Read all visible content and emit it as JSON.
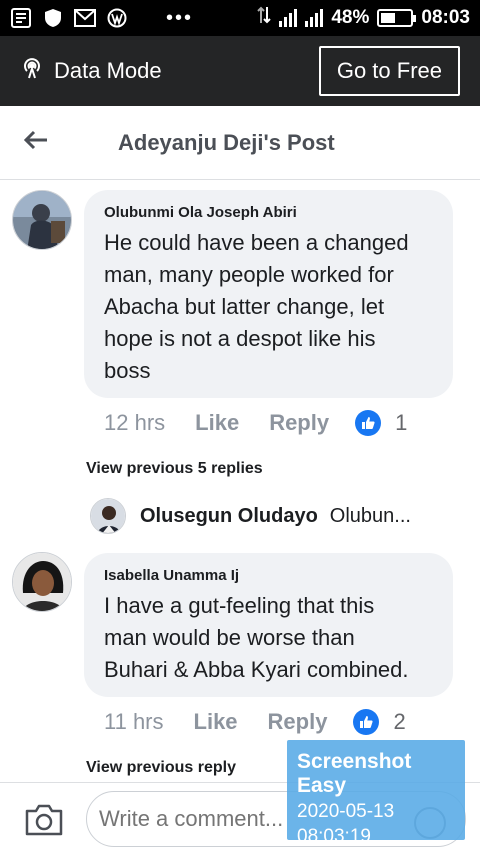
{
  "status_bar": {
    "battery": "48%",
    "time": "08:03",
    "battery_level": 0.48,
    "icons": [
      "news-icon",
      "shield-icon",
      "gmail-icon",
      "wordpress-icon"
    ]
  },
  "data_bar": {
    "label": "Data Mode",
    "go_free": "Go to Free"
  },
  "header": {
    "title": "Adeyanju Deji's Post"
  },
  "comments": [
    {
      "author": "Olubunmi Ola Joseph Abiri",
      "text_lines": [
        "He could have been a changed",
        "man, many people worked for",
        "Abacha but latter change, let",
        "hope is not a despot like his",
        "boss"
      ],
      "time": "12 hrs",
      "like": "Like",
      "reply": "Reply",
      "likes": "1",
      "view_replies": "View previous 5 replies",
      "reply_preview": {
        "name": "Olusegun Oludayo",
        "text": "Olubun..."
      }
    },
    {
      "author": "Isabella Unamma Ij",
      "text_lines": [
        "I have a gut-feeling that this",
        "man would be worse than",
        "Buhari & Abba Kyari combined."
      ],
      "time": "11 hrs",
      "like": "Like",
      "reply": "Reply",
      "likes": "2",
      "view_replies": "View previous reply"
    }
  ],
  "composer": {
    "placeholder": "Write a comment..."
  },
  "overlay": {
    "title": "Screenshot Easy",
    "date": "2020-05-13",
    "time": "08:03:19"
  }
}
